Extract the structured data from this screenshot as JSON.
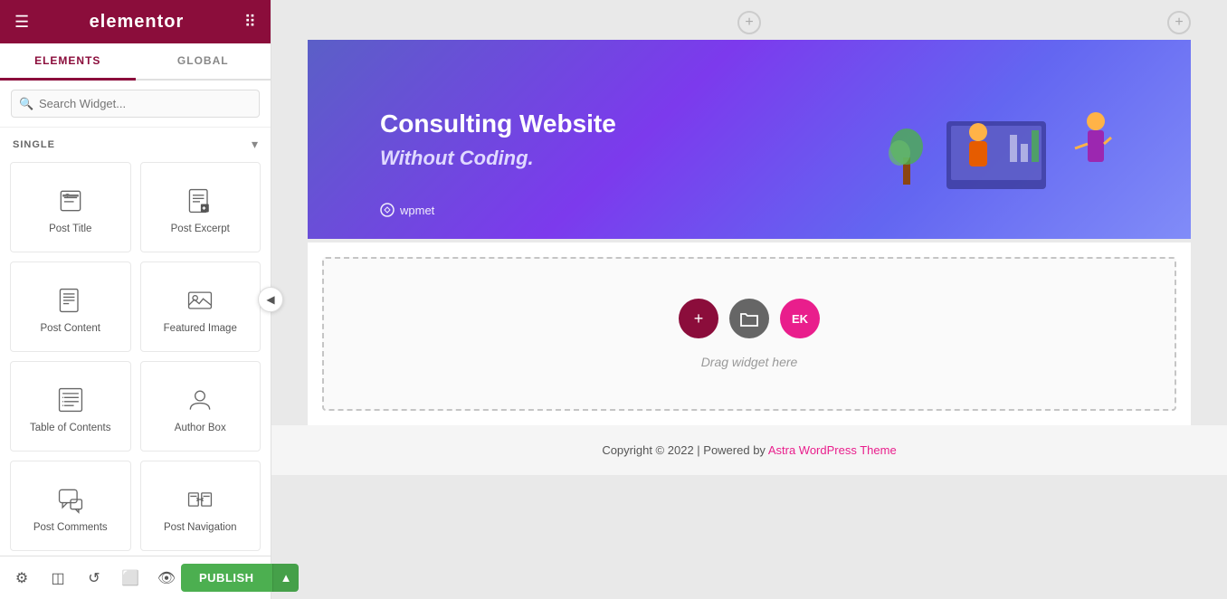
{
  "sidebar": {
    "logo": "elementor",
    "hamburger_icon": "☰",
    "grid_icon": "⋮⋮",
    "tabs": [
      {
        "label": "ELEMENTS",
        "active": true
      },
      {
        "label": "GLOBAL",
        "active": false
      }
    ],
    "search_placeholder": "Search Widget...",
    "section_label": "SINGLE",
    "widgets": [
      {
        "id": "post-title",
        "label": "Post Title",
        "icon": "post-title-icon"
      },
      {
        "id": "post-excerpt",
        "label": "Post Excerpt",
        "icon": "post-excerpt-icon"
      },
      {
        "id": "post-content",
        "label": "Post Content",
        "icon": "post-content-icon"
      },
      {
        "id": "featured-image",
        "label": "Featured Image",
        "icon": "featured-image-icon"
      },
      {
        "id": "table-of-contents",
        "label": "Table of Contents",
        "icon": "table-of-contents-icon"
      },
      {
        "id": "author-box",
        "label": "Author Box",
        "icon": "author-box-icon"
      },
      {
        "id": "post-comments",
        "label": "Post Comments",
        "icon": "post-comments-icon"
      },
      {
        "id": "post-navigation",
        "label": "Post Navigation",
        "icon": "post-navigation-icon"
      }
    ],
    "bottom_icons": [
      "settings-icon",
      "layers-icon",
      "history-icon",
      "responsive-icon",
      "eye-icon"
    ],
    "publish_label": "PUBLISH"
  },
  "canvas": {
    "hero": {
      "title": "Consulting Website",
      "subtitle": "Without Coding.",
      "logo_text": "wpmet"
    },
    "drop_zone": {
      "label": "Drag widget here",
      "icons": [
        {
          "type": "plus",
          "label": "+"
        },
        {
          "type": "folder",
          "label": "🗀"
        },
        {
          "type": "ek",
          "label": "EK"
        }
      ]
    },
    "footer": {
      "text": "Copyright © 2022 | Powered by ",
      "link_text": "Astra WordPress Theme",
      "link_url": "#"
    }
  }
}
